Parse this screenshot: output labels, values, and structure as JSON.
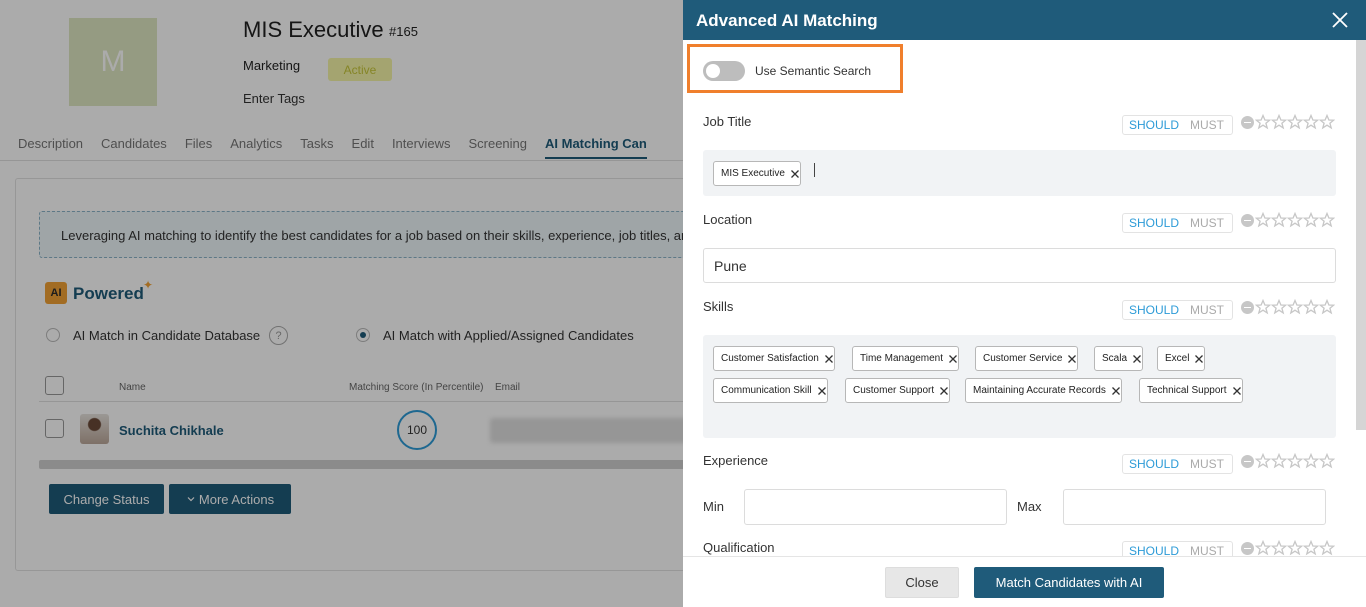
{
  "job": {
    "avatar_letter": "M",
    "title": "MIS Executive",
    "id": "#165",
    "department": "Marketing",
    "status": "Active",
    "tags_placeholder": "Enter Tags"
  },
  "tabs": [
    "Description",
    "Candidates",
    "Files",
    "Analytics",
    "Tasks",
    "Edit",
    "Interviews",
    "Screening",
    "AI Matching Can"
  ],
  "active_tab_index": 8,
  "main": {
    "info_text": "Leveraging AI matching to identify the best candidates for a job based on their skills, experience, job titles, an",
    "ai_badge": "AI",
    "powered_label": "Powered",
    "radio_database": "AI Match in Candidate Database",
    "radio_applied": "AI Match with Applied/Assigned Candidates",
    "help_icon": "?",
    "columns": {
      "name": "Name",
      "score": "Matching Score (In Percentile)",
      "email": "Email"
    },
    "candidate": {
      "name": "Suchita Chikhale",
      "score": "100"
    },
    "change_status_button": "Change Status",
    "more_actions_button": "More Actions"
  },
  "drawer": {
    "title": "Advanced AI Matching",
    "semantic_search_label": "Use Semantic Search",
    "semantic_search_on": false,
    "should_label": "SHOULD",
    "must_label": "MUST",
    "job_title": {
      "label": "Job Title",
      "chips": [
        "MIS Executive"
      ]
    },
    "location": {
      "label": "Location",
      "value": "Pune"
    },
    "skills": {
      "label": "Skills",
      "chips": [
        "Customer Satisfaction",
        "Time Management",
        "Customer Service",
        "Scala",
        "Excel",
        "Communication Skill",
        "Customer Support",
        "Maintaining Accurate Records",
        "Technical Support"
      ]
    },
    "experience": {
      "label": "Experience",
      "min_label": "Min",
      "max_label": "Max",
      "min_value": "",
      "max_value": ""
    },
    "qualification": {
      "label": "Qualification"
    },
    "close_button": "Close",
    "match_button": "Match Candidates with AI"
  },
  "colors": {
    "primary": "#1f5b7a",
    "accent": "#2d9bd7",
    "highlight": "#f07f2c"
  }
}
